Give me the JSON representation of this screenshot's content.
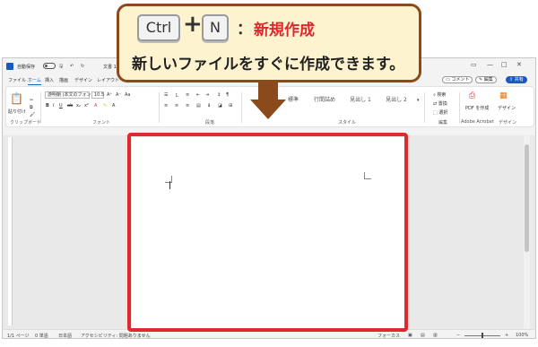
{
  "callout": {
    "key_ctrl": "Ctrl",
    "key_n": "N",
    "plus": "+",
    "colon": "：",
    "title": "新規作成",
    "description": "新しいファイルをすぐに作成できます。"
  },
  "titlebar": {
    "autosave": "自動保存",
    "doc_title": "文書 1",
    "search": "検索"
  },
  "menu": {
    "items": [
      "ファイル",
      "ホーム",
      "挿入",
      "描画",
      "デザイン",
      "レイアウト"
    ],
    "comment": "コメント",
    "edit": "編集",
    "share": "共有"
  },
  "ribbon": {
    "paste": "貼り付け",
    "font_name": "游明朝 (本文のフォント",
    "font_size": "10.5",
    "styles": [
      "標準",
      "行間詰め",
      "見出し 1",
      "見出し 2"
    ],
    "search": "検索",
    "replace": "置換",
    "select": "選択",
    "pdf": "PDF を作成",
    "design": "デザイン",
    "groups": {
      "clipboard": "クリップボード",
      "font": "フォント",
      "paragraph": "段落",
      "style": "スタイル",
      "edit": "編集",
      "acrobat": "Adobe Acrobat",
      "designer": "デザイン"
    }
  },
  "status": {
    "page": "1/1 ページ",
    "words": "0 単語",
    "language": "日本語",
    "accessibility": "アクセシビリティ: 問題ありません",
    "focus": "フォーカス",
    "zoom": "100%"
  },
  "colors": {
    "highlight": "#e0282e",
    "callout_border": "#8b4a1c",
    "callout_bg": "#fdf4cf",
    "word_blue": "#185abd"
  }
}
